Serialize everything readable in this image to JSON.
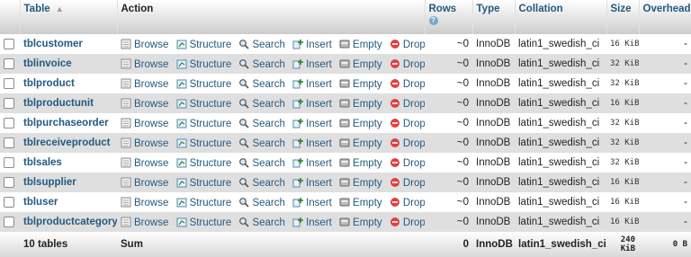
{
  "header": {
    "table": "Table",
    "action": "Action",
    "rows": "Rows",
    "type": "Type",
    "collation": "Collation",
    "size": "Size",
    "overhead": "Overhead"
  },
  "actions": {
    "browse": "Browse",
    "structure": "Structure",
    "search": "Search",
    "insert": "Insert",
    "empty": "Empty",
    "drop": "Drop"
  },
  "rows": [
    {
      "name": "tblcustomer",
      "rows": "~0",
      "type": "InnoDB",
      "collation": "latin1_swedish_ci",
      "size": "16 KiB",
      "overhead": "-"
    },
    {
      "name": "tblinvoice",
      "rows": "~0",
      "type": "InnoDB",
      "collation": "latin1_swedish_ci",
      "size": "32 KiB",
      "overhead": "-"
    },
    {
      "name": "tblproduct",
      "rows": "~0",
      "type": "InnoDB",
      "collation": "latin1_swedish_ci",
      "size": "32 KiB",
      "overhead": "-"
    },
    {
      "name": "tblproductunit",
      "rows": "~0",
      "type": "InnoDB",
      "collation": "latin1_swedish_ci",
      "size": "16 KiB",
      "overhead": "-"
    },
    {
      "name": "tblpurchaseorder",
      "rows": "~0",
      "type": "InnoDB",
      "collation": "latin1_swedish_ci",
      "size": "32 KiB",
      "overhead": "-"
    },
    {
      "name": "tblreceiveproduct",
      "rows": "~0",
      "type": "InnoDB",
      "collation": "latin1_swedish_ci",
      "size": "32 KiB",
      "overhead": "-"
    },
    {
      "name": "tblsales",
      "rows": "~0",
      "type": "InnoDB",
      "collation": "latin1_swedish_ci",
      "size": "32 KiB",
      "overhead": "-"
    },
    {
      "name": "tblsupplier",
      "rows": "~0",
      "type": "InnoDB",
      "collation": "latin1_swedish_ci",
      "size": "16 KiB",
      "overhead": "-"
    },
    {
      "name": "tbluser",
      "rows": "~0",
      "type": "InnoDB",
      "collation": "latin1_swedish_ci",
      "size": "16 KiB",
      "overhead": "-"
    },
    {
      "name": "tblproductcategory",
      "rows": "~0",
      "type": "InnoDB",
      "collation": "latin1_swedish_ci",
      "size": "16 KiB",
      "overhead": "-"
    }
  ],
  "footer": {
    "tables": "10 tables",
    "sum": "Sum",
    "rows": "0",
    "type": "InnoDB",
    "collation": "latin1_swedish_ci",
    "size_line1": "240",
    "size_line2": "KiB",
    "overhead": "0 B"
  },
  "icons": {
    "sort": "sort-asc-icon",
    "help": "help-icon",
    "browse": "browse-icon",
    "structure": "structure-icon",
    "search": "search-icon",
    "insert": "insert-icon",
    "empty": "empty-icon",
    "drop": "drop-icon"
  },
  "colors": {
    "link": "#235a81",
    "drop": "#e04040",
    "row_alt": "#dfdfdf"
  }
}
